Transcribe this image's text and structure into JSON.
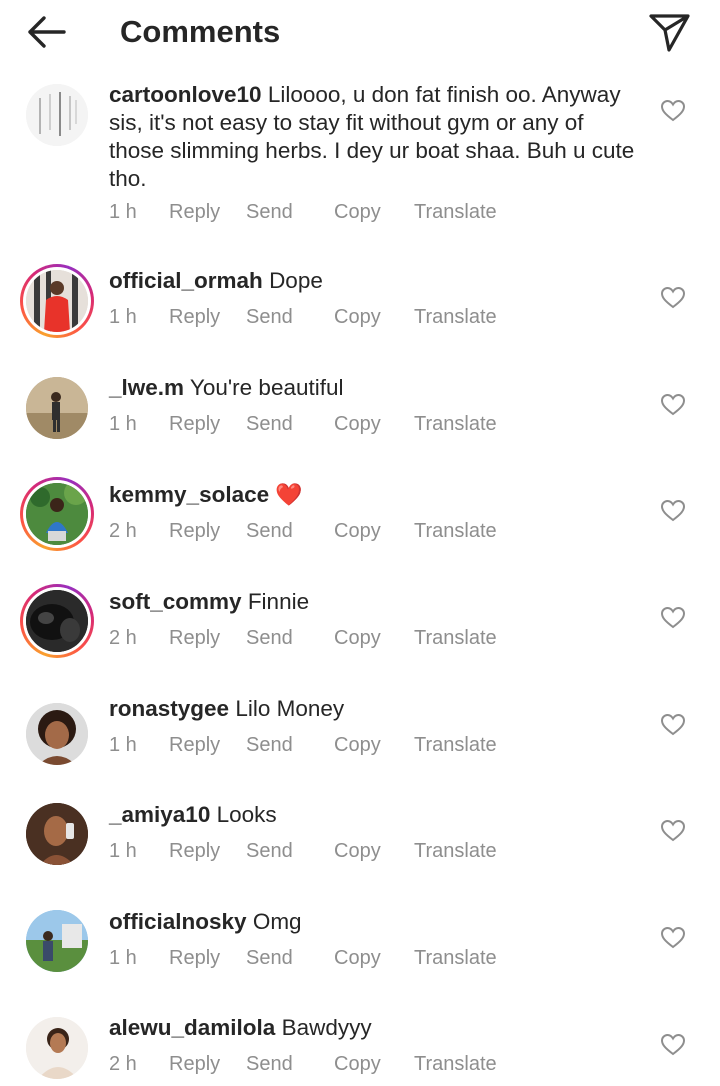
{
  "header": {
    "title": "Comments",
    "back_icon": "arrow-left-icon",
    "share_icon": "paper-plane-icon"
  },
  "action_labels": {
    "reply": "Reply",
    "send": "Send",
    "copy": "Copy",
    "translate": "Translate"
  },
  "comments": [
    {
      "username": "cartoonlove10",
      "text": "Liloooo, u don fat finish oo. Anyway sis, it's not easy to stay fit without gym or any of those slimming herbs. I dey ur boat shaa. Buh u cute tho.",
      "time": "1 h"
    },
    {
      "username": "official_ormah",
      "text": "Dope",
      "time": "1 h"
    },
    {
      "username": "_lwe.m",
      "text": "You're beautiful",
      "time": "1 h"
    },
    {
      "username": "kemmy_solace",
      "text": "",
      "emoji": "❤️",
      "time": "2 h"
    },
    {
      "username": "soft_commy",
      "text": "Finnie",
      "time": "2 h"
    },
    {
      "username": "ronastygee",
      "text": "Lilo Money",
      "time": "1 h"
    },
    {
      "username": "_amiya10",
      "text": "Looks",
      "time": "1 h"
    },
    {
      "username": "officialnosky",
      "text": "Omg",
      "time": "1 h"
    },
    {
      "username": "alewu_damilola",
      "text": "Bawdyyy",
      "time": "2 h"
    }
  ],
  "colors": {
    "text": "#262626",
    "secondary": "#8e8e8e",
    "heart_emoji": "#e0245e"
  }
}
